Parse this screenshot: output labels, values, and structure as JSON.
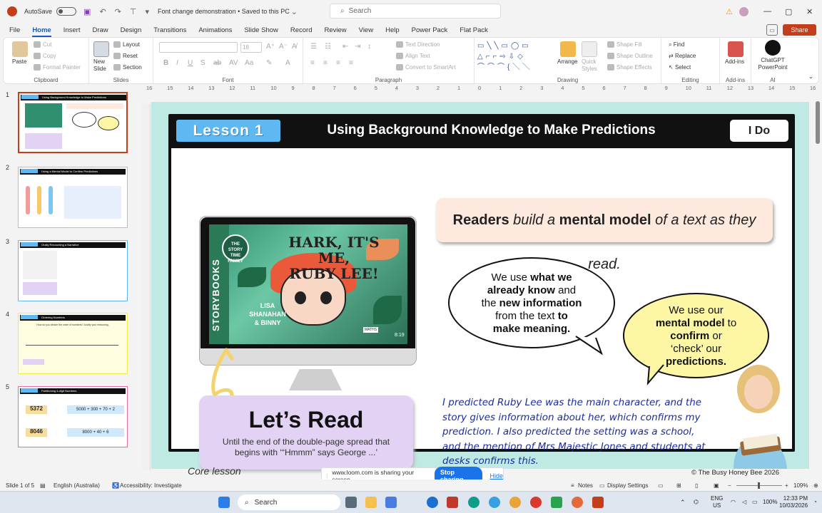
{
  "titlebar": {
    "autosave_label": "AutoSave",
    "toggle_state": "Off",
    "doc_title": "Font change demonstration • Saved to this PC",
    "search_placeholder": "Search"
  },
  "menu": [
    "File",
    "Home",
    "Insert",
    "Draw",
    "Design",
    "Transitions",
    "Animations",
    "Slide Show",
    "Record",
    "Review",
    "View",
    "Help",
    "Power Pack",
    "Flat Pack"
  ],
  "menu_active": "Home",
  "share_label": "Share",
  "ribbon": {
    "clipboard": {
      "paste": "Paste",
      "cut": "Cut",
      "copy": "Copy",
      "format_painter": "Format Painter",
      "label": "Clipboard"
    },
    "slides": {
      "new_slide": "New Slide",
      "layout": "Layout",
      "reset": "Reset",
      "section": "Section",
      "label": "Slides"
    },
    "font": {
      "font_size": "18",
      "label": "Font"
    },
    "paragraph": {
      "text_direction": "Text Direction",
      "align_text": "Align Text",
      "smartart": "Convert to SmartArt",
      "label": "Paragraph"
    },
    "drawing": {
      "arrange": "Arrange",
      "quick_styles": "Quick Styles",
      "shape_fill": "Shape Fill",
      "shape_outline": "Shape Outline",
      "shape_effects": "Shape Effects",
      "label": "Drawing"
    },
    "editing": {
      "find": "Find",
      "replace": "Replace",
      "select": "Select",
      "label": "Editing"
    },
    "addins": {
      "addins": "Add-ins",
      "label": "Add-ins"
    },
    "ai": {
      "chatgpt": "ChatGPT PowerPoint",
      "label": "AI"
    }
  },
  "ruler_ticks": [
    "16",
    "15",
    "14",
    "13",
    "12",
    "11",
    "10",
    "9",
    "8",
    "7",
    "6",
    "5",
    "4",
    "3",
    "2",
    "1",
    "0",
    "1",
    "2",
    "3",
    "4",
    "5",
    "6",
    "7",
    "8",
    "9",
    "10",
    "11",
    "12",
    "13",
    "14",
    "15",
    "16"
  ],
  "thumbnails": [
    {
      "num": "1",
      "title": "Using Background Knowledge to Make Predictions",
      "selected": true
    },
    {
      "num": "2",
      "title": "Using a Mental Model to Confirm Predictions",
      "selected": false
    },
    {
      "num": "3",
      "title": "Orally Recounting a Narrative",
      "selected": false
    },
    {
      "num": "4",
      "title": "Ordering Numbers",
      "selected": false
    },
    {
      "num": "5",
      "title": "Partitioning 4-digit Numbers",
      "selected": false
    }
  ],
  "thumb_details": {
    "t4_question": "How do you decide the order of numbers? Justify your reasoning.",
    "t5_row1_num": "5372",
    "t5_row1_expr": "5000 + 300 + 70 + 2",
    "t5_row2_num": "8046",
    "t5_row2_expr": "8000 + 40 + 6"
  },
  "slide": {
    "lesson_badge": "Lesson 1",
    "title": "Using Background Knowledge to Make Predictions",
    "tag": "I Do",
    "readers_pre": "Readers",
    "readers_mid1": " build a ",
    "readers_bold": "mental model",
    "readers_end": " of a text as they read.",
    "book": {
      "series": "STORYBOOKS",
      "badge": "THE STORY TIME FAMILY",
      "title_line1": "HARK, IT'S ME,",
      "title_line2": "RUBY LEE!",
      "authors": "LISA SHANAHAN & BINNY",
      "video_time": "8:19",
      "maths_badge": "MATHS"
    },
    "bubble1": {
      "l1_pre": "We use ",
      "l1_bold": "what we",
      "l2_bold": "already know",
      "l2_post": " and",
      "l3_pre": "the ",
      "l3_bold": "new information",
      "l4_pre": "from the text ",
      "l4_bold": "to",
      "l5_bold": "make meaning."
    },
    "bubble2": {
      "l1": "We use our",
      "l2_bold": "mental model",
      "l2_post": " to",
      "l3_bold": "confirm",
      "l3_post": " or",
      "l4": "‘check’ our",
      "l5_bold": "predictions."
    },
    "letsread_title": "Let’s Read",
    "letsread_sub": "Until the end of the double-page spread that begins with ‘“Hmmm” says George ...’",
    "prediction": "I predicted Ruby Lee was the main character, and the story gives information about her, which confirms my prediction. I also predicted the setting was a school, and the mention of Mrs Majestic Jones and students at desks confirms this.",
    "footer_left": "Core lesson",
    "footer_right": "© The Busy Honey Bee 2026"
  },
  "share_banner": {
    "text": "www.loom.com is sharing your screen.",
    "stop": "Stop sharing",
    "hide": "Hide"
  },
  "status": {
    "slide_count": "Slide 1 of 5",
    "language": "English (Australia)",
    "accessibility": "Accessibility: Investigate",
    "notes": "Notes",
    "display": "Display Settings",
    "zoom": "109%"
  },
  "taskbar": {
    "search": "Search",
    "lang1": "ENG",
    "lang2": "US",
    "battery": "100%",
    "time": "12:33 PM",
    "date": "10/03/2026"
  },
  "colors": {
    "accent": "#c43e1c",
    "lesson_badge": "#5fb8f1",
    "canvas_bg": "#bfe9e3",
    "prediction_text": "#1b2c9a",
    "bubble2_bg": "#fdf7a5",
    "letsread_bg": "#e2d2f3",
    "readers_bg": "#fde9dd"
  }
}
